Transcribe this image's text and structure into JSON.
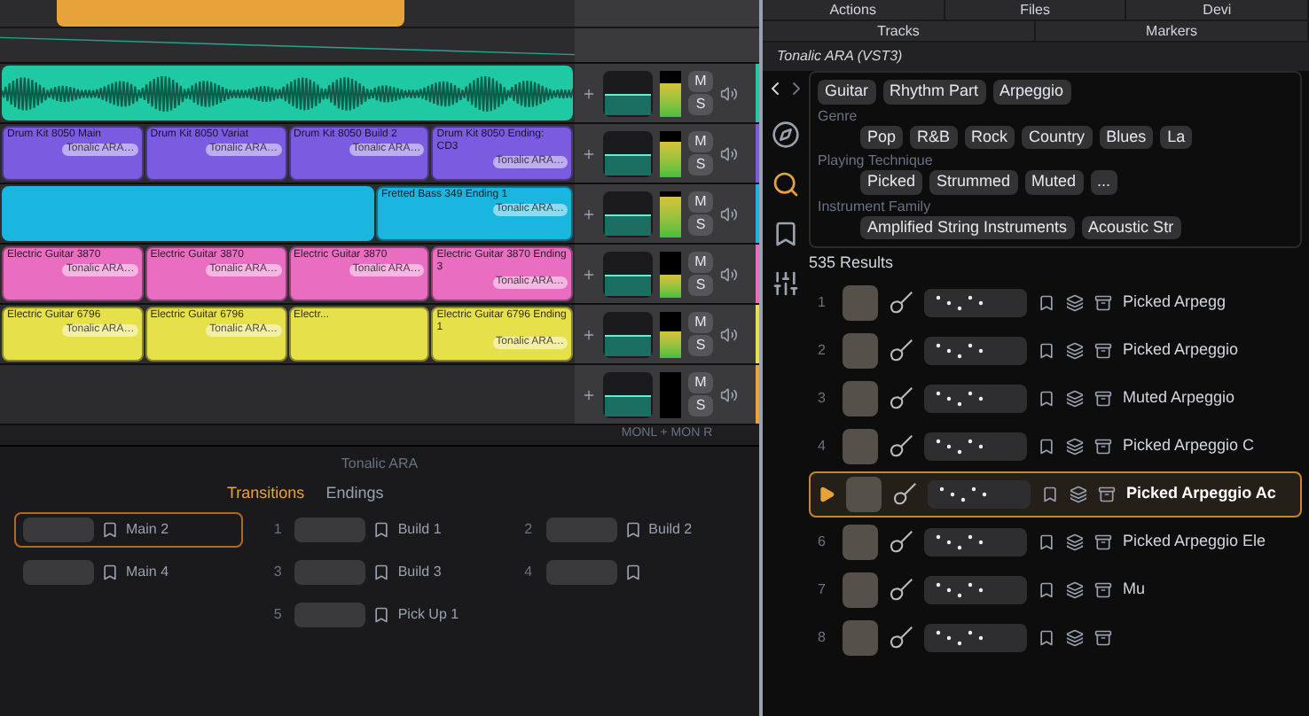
{
  "menu": {
    "rows": [
      [
        "Actions",
        "Files",
        "Devi"
      ],
      [
        "Tracks",
        "Markers"
      ]
    ]
  },
  "arrangement": {
    "tracks": [
      {
        "kind": "audio",
        "color": "#1fc9a4",
        "meter": {
          "level": 0.7
        },
        "mute": "M",
        "solo": "S"
      },
      {
        "kind": "pattern",
        "color": "#7b5ce0",
        "clips": [
          {
            "name": "Drum Kit 8050 Main",
            "sub": "Tonalic ARA…"
          },
          {
            "name": "Drum Kit 8050 Variat",
            "sub": "Tonalic ARA…"
          },
          {
            "name": "Drum Kit 8050 Build 2",
            "sub": "Tonalic ARA…"
          },
          {
            "name": "Drum Kit 8050 Ending: CD3",
            "sub": "Tonalic ARA…"
          }
        ],
        "meter": {
          "level": 0.75
        },
        "mute": "M",
        "solo": "S"
      },
      {
        "kind": "pattern",
        "color": "#1ab6e0",
        "clips": [
          {
            "name": "Fretted Bass 349 Ending 1",
            "sub": "Tonalic ARA…"
          }
        ],
        "meter": {
          "level": 0.85
        },
        "mute": "M",
        "solo": "S"
      },
      {
        "kind": "pattern",
        "color": "#e96ec2",
        "clips": [
          {
            "name": "Electric Guitar 3870",
            "sub": "Tonalic ARA…"
          },
          {
            "name": "Electric Guitar 3870",
            "sub": "Tonalic ARA…"
          },
          {
            "name": "Electric Guitar 3870",
            "sub": "Tonalic ARA…"
          },
          {
            "name": "Electric Guitar 3870 Ending 3",
            "sub": "Tonalic ARA…"
          }
        ],
        "meter": {
          "level": 0.5
        },
        "mute": "M",
        "solo": "S"
      },
      {
        "kind": "pattern",
        "color": "#e6e04a",
        "clips": [
          {
            "name": "Electric Guitar 6796",
            "sub": "Tonalic ARA…"
          },
          {
            "name": "Electric Guitar 6796",
            "sub": "Tonalic ARA…"
          },
          {
            "name": "Electr..."
          },
          {
            "name": "Electric Guitar 6796 Ending 1",
            "sub": "Tonalic ARA…"
          }
        ],
        "meter": {
          "level": 0.55
        },
        "mute": "M",
        "solo": "S"
      },
      {
        "kind": "empty",
        "color": "#e8a23a",
        "mute": "M",
        "solo": "S"
      }
    ],
    "master_label": "MONL + MON R"
  },
  "bottom_panel": {
    "title": "Tonalic ARA",
    "tabs": [
      {
        "label": "Transitions",
        "selected": true
      },
      {
        "label": "Endings",
        "selected": false
      }
    ],
    "columns": [
      [
        {
          "name": "Main 2",
          "selected": true
        },
        {
          "name": "Main 4",
          "selected": false
        }
      ],
      [
        {
          "number": "1",
          "name": "Build 1",
          "selected": false
        },
        {
          "number": "3",
          "name": "Build 3",
          "selected": false
        },
        {
          "number": "5",
          "name": "Pick Up 1",
          "selected": false
        }
      ],
      [
        {
          "number": "2",
          "name": "Build 2",
          "selected": false
        },
        {
          "number": "4",
          "selected": false
        }
      ]
    ]
  },
  "plugin": {
    "title": "Tonalic ARA (VST3)",
    "nav": [
      {
        "selected": false
      },
      {
        "selected": true
      },
      {
        "selected": false
      },
      {
        "selected": false
      }
    ],
    "search_tags": [
      "Guitar",
      "Rhythm Part",
      "Arpeggio"
    ],
    "filters": [
      {
        "label": "Genre",
        "options": [
          "Pop",
          "R&B",
          "Rock",
          "Country",
          "Blues",
          "La"
        ]
      },
      {
        "label": "Playing Technique",
        "options": [
          "Picked",
          "Strummed",
          "Muted",
          "..."
        ]
      },
      {
        "label": "Instrument Family",
        "options": [
          "Amplified String Instruments",
          "Acoustic Str"
        ]
      }
    ],
    "results_count": "535 Results",
    "results": [
      {
        "number": "1",
        "name": "Picked Arpegg",
        "selected": false
      },
      {
        "number": "2",
        "name": "Picked Arpeggio",
        "selected": false
      },
      {
        "number": "3",
        "name": "Muted Arpeggio",
        "selected": false
      },
      {
        "number": "4",
        "name": "Picked Arpeggio C",
        "selected": false
      },
      {
        "name": "Picked Arpeggio Ac",
        "selected": true
      },
      {
        "number": "6",
        "name": "Picked Arpeggio Ele",
        "selected": false
      },
      {
        "number": "7",
        "name": "Mu",
        "selected": false
      },
      {
        "number": "8",
        "selected": false
      }
    ]
  }
}
